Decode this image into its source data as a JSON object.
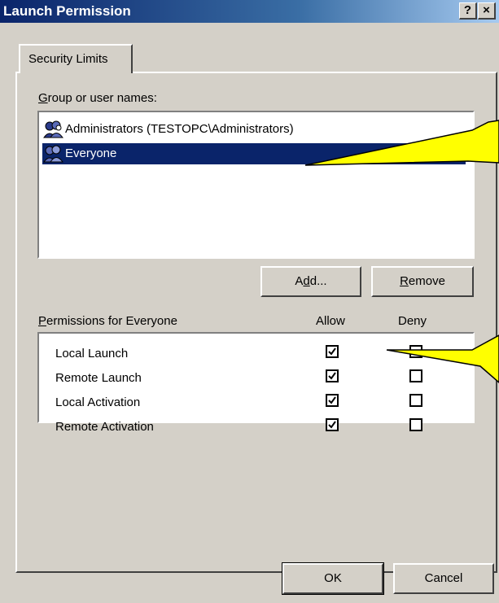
{
  "window": {
    "title": "Launch Permission",
    "help_label": "?",
    "close_label": "✕"
  },
  "tabs": [
    {
      "label": "Security Limits",
      "active": true
    }
  ],
  "users_section": {
    "label_prefix": "",
    "label_mnemonic": "G",
    "label_rest": "roup or user names:",
    "items": [
      {
        "name": "Administrators (TESTOPC\\Administrators)",
        "selected": false
      },
      {
        "name": "Everyone",
        "selected": true
      }
    ]
  },
  "buttons": {
    "add_mnemonic": "d",
    "add_pre": "A",
    "add_post": "d...",
    "remove_mnemonic": "R",
    "remove_post": "emove",
    "ok_label": "OK",
    "cancel_label": "Cancel"
  },
  "permissions_section": {
    "label_mnemonic": "P",
    "label_rest": "ermissions for Everyone",
    "allow_header": "Allow",
    "deny_header": "Deny",
    "rows": [
      {
        "name": "Local Launch",
        "allow": true,
        "deny": false
      },
      {
        "name": "Remote Launch",
        "allow": true,
        "deny": false
      },
      {
        "name": "Local Activation",
        "allow": true,
        "deny": false
      },
      {
        "name": "Remote Activation",
        "allow": true,
        "deny": false
      }
    ]
  },
  "colors": {
    "selection": "#0a246a",
    "callout_fill": "#ffff00",
    "face": "#d4d0c8"
  }
}
